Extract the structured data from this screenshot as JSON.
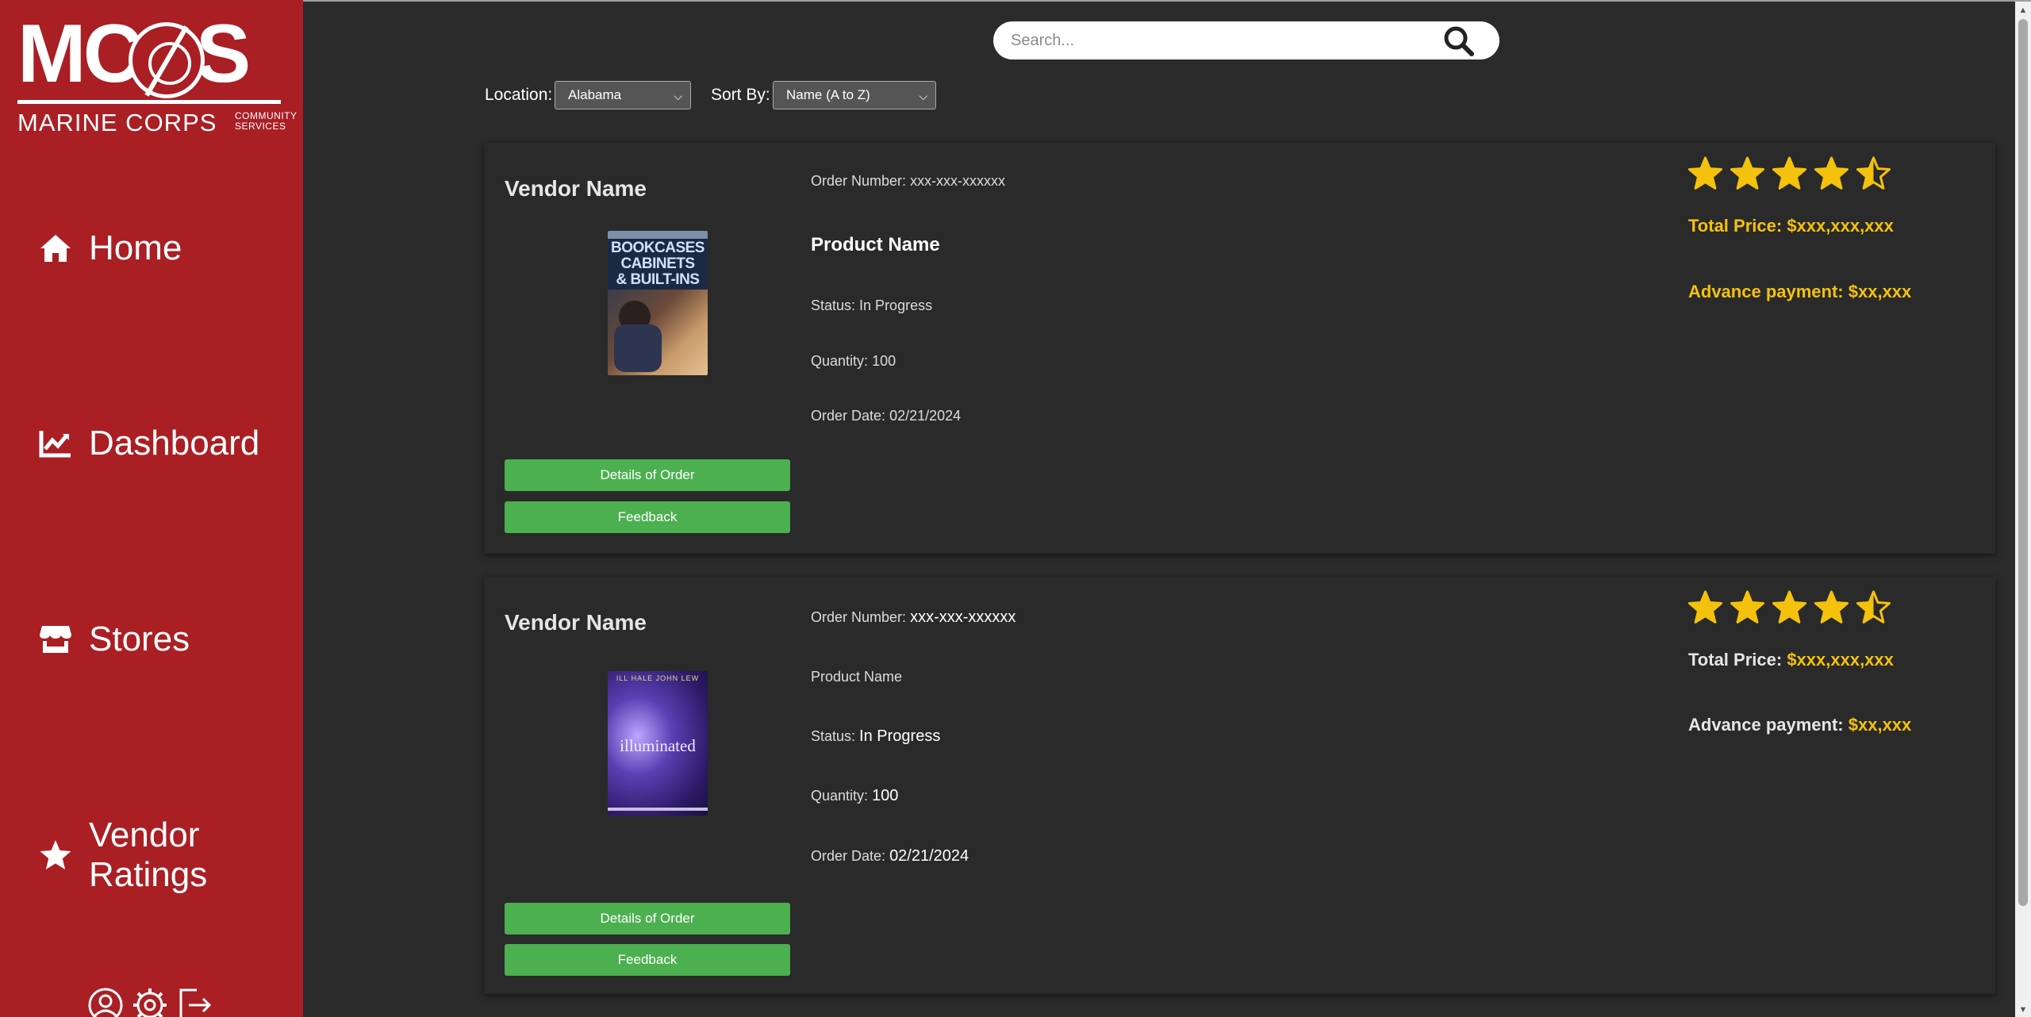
{
  "brand": {
    "logo_text": "MCCS",
    "subtitle": "MARINE CORPS",
    "community": "COMMUNITY",
    "services": "SERVICES"
  },
  "sidebar": {
    "items": [
      {
        "label": "Home",
        "icon": "home-icon"
      },
      {
        "label": "Dashboard",
        "icon": "chart-line-icon"
      },
      {
        "label": "Stores",
        "icon": "store-icon"
      },
      {
        "label": "Vendor",
        "label2": "Ratings",
        "icon": "star-icon"
      }
    ],
    "bottom_icons": [
      "user-profile-icon",
      "settings-gear-icon",
      "logout-icon"
    ]
  },
  "search": {
    "placeholder": "Search...",
    "icon": "search-icon"
  },
  "filters": {
    "location_label": "Location:",
    "location_value": "Alabama",
    "sort_label": "Sort By:",
    "sort_value": "Name (A to Z)"
  },
  "orders": [
    {
      "vendor_name": "Vendor Name",
      "order_number_label": "Order Number:",
      "order_number": "xxx-xxx-xxxxxx",
      "product_name": "Product Name",
      "status_label": "Status:",
      "status": "In Progress",
      "quantity_label": "Quantity:",
      "quantity": "100",
      "order_date_label": "Order Date:",
      "order_date": "02/21/2024",
      "rating": 4.5,
      "total_price_label": "Total Price:",
      "total_price": "$xxx,xxx,xxx",
      "advance_label": "Advance payment:",
      "advance": "$xx,xxx",
      "details_button": "Details of Order",
      "feedback_button": "Feedback",
      "thumb_lines": [
        "BOOKCASES",
        "CABINETS",
        "& BUILT-INS"
      ]
    },
    {
      "vendor_name": "Vendor Name",
      "order_number_label": "Order Number:",
      "order_number": "xxx-xxx-xxxxxx",
      "product_name": "Product Name",
      "status_label": "Status:",
      "status": "In Progress",
      "quantity_label": "Quantity:",
      "quantity": "100",
      "order_date_label": "Order Date:",
      "order_date": "02/21/2024",
      "rating": 4.5,
      "total_price_label": "Total Price:",
      "total_price": "$xxx,xxx,xxx",
      "advance_label": "Advance payment:",
      "advance": "$xx,xxx",
      "details_button": "Details of Order",
      "feedback_button": "Feedback",
      "thumb_title": "illuminated",
      "thumb_authors": "ILL HALE   JOHN LEW"
    }
  ],
  "colors": {
    "sidebar": "#a91f24",
    "background": "#2b2b2b",
    "accent_green": "#4caf50",
    "star_gold": "#f4c20d"
  }
}
